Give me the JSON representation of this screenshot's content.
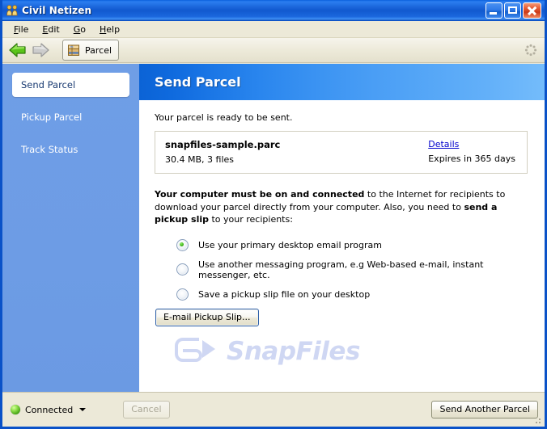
{
  "window": {
    "title": "Civil Netizen",
    "icon": "people-icon",
    "controls": {
      "minimize": "minimize-button",
      "maximize": "maximize-button",
      "close": "close-button"
    }
  },
  "menu": {
    "items": [
      {
        "label": "File",
        "accel": "F"
      },
      {
        "label": "Edit",
        "accel": "E"
      },
      {
        "label": "Go",
        "accel": "G"
      },
      {
        "label": "Help",
        "accel": "H"
      }
    ]
  },
  "toolbar": {
    "back": "back-arrow",
    "forward": "forward-arrow",
    "parcel_label": "Parcel",
    "parcel_icon": "package-box-icon",
    "activity_icon": "activity-spinner-icon"
  },
  "sidebar": {
    "items": [
      {
        "label": "Send Parcel",
        "selected": true
      },
      {
        "label": "Pickup Parcel",
        "selected": false
      },
      {
        "label": "Track Status",
        "selected": false
      }
    ]
  },
  "main": {
    "banner_title": "Send Parcel",
    "lead": "Your parcel is ready to be sent.",
    "parcel": {
      "name": "snapfiles-sample.parc",
      "meta": "30.4 MB, 3 files",
      "details_link": "Details",
      "expires": "Expires in 365 days"
    },
    "notice": {
      "bold1": "Your computer must be on and connected",
      "text1": " to the Internet for recipients to download your parcel directly from your computer. Also, you need to ",
      "bold2": "send a pickup slip",
      "text2": " to your recipients:"
    },
    "options": [
      {
        "label": "Use your primary desktop email program",
        "checked": true
      },
      {
        "label": "Use another messaging program, e.g Web-based e-mail, instant messenger, etc.",
        "checked": false
      },
      {
        "label": "Save a pickup slip file on your desktop",
        "checked": false
      }
    ],
    "email_button": "E-mail Pickup Slip...",
    "watermark_text": "SnapFiles"
  },
  "status": {
    "connection": "Connected",
    "connection_indicator": "green",
    "cancel_label": "Cancel",
    "cancel_disabled": true,
    "send_another_label": "Send Another Parcel"
  },
  "colors": {
    "titlebar_blue": "#1159cf",
    "sidebar_blue": "#6d9ce5",
    "banner_start": "#0b63d6",
    "banner_end": "#74bcfb",
    "link_blue": "#0000cc",
    "chrome": "#ece9d8",
    "status_green": "#3f9e10"
  }
}
